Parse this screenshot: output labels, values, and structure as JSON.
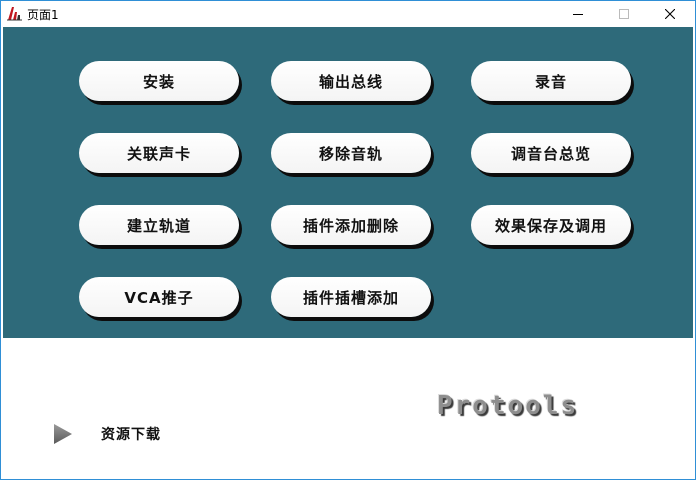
{
  "window": {
    "title": "页面1",
    "controls": {
      "minimize": "minimize-icon",
      "maximize": "maximize-icon",
      "close": "close-icon"
    }
  },
  "panel": {
    "background": "#2e6a7a",
    "buttons": [
      {
        "label": "安装"
      },
      {
        "label": "输出总线"
      },
      {
        "label": "录音"
      },
      {
        "label": "关联声卡"
      },
      {
        "label": "移除音轨"
      },
      {
        "label": "调音台总览"
      },
      {
        "label": "建立轨道"
      },
      {
        "label": "插件添加删除"
      },
      {
        "label": "效果保存及调用"
      },
      {
        "label": "VCA推子"
      },
      {
        "label": "插件插槽添加"
      }
    ]
  },
  "footer": {
    "download_label": "资源下载",
    "download_icon": "play-icon",
    "brand_logo": "Protools"
  }
}
